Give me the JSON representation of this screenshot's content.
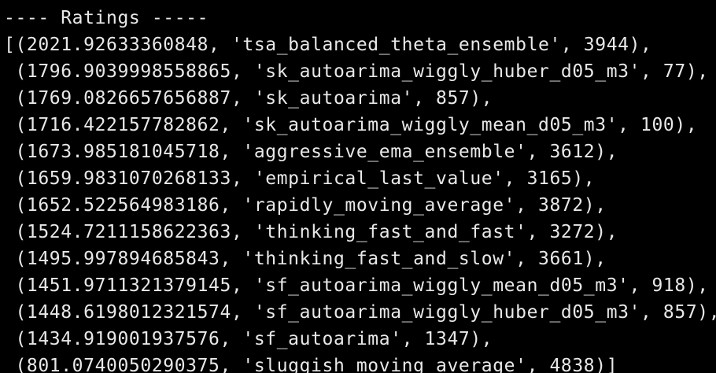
{
  "terminal": {
    "lines": [
      "---- Ratings -----",
      "[(2021.92633360848, 'tsa_balanced_theta_ensemble', 3944),",
      " (1796.9039998558865, 'sk_autoarima_wiggly_huber_d05_m3', 77),",
      " (1769.0826657656887, 'sk_autoarima', 857),",
      " (1716.422157782862, 'sk_autoarima_wiggly_mean_d05_m3', 100),",
      " (1673.985181045718, 'aggressive_ema_ensemble', 3612),",
      " (1659.9831070268133, 'empirical_last_value', 3165),",
      " (1652.522564983186, 'rapidly_moving_average', 3872),",
      " (1524.7211158622363, 'thinking_fast_and_fast', 3272),",
      " (1495.997894685843, 'thinking_fast_and_slow', 3661),",
      " (1451.9711321379145, 'sf_autoarima_wiggly_mean_d05_m3', 918),",
      " (1448.6198012321574, 'sf_autoarima_wiggly_huber_d05_m3', 857),",
      " (1434.919001937576, 'sf_autoarima', 1347),",
      " (801.0740050290375, 'sluggish_moving_average', 4838)]"
    ]
  },
  "colors": {
    "background": "#000000",
    "text": "#e8e8e8"
  }
}
